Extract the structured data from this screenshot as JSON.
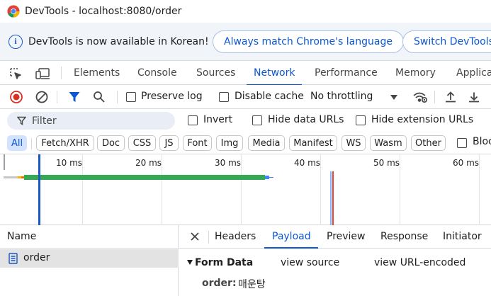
{
  "window": {
    "title": "DevTools - localhost:8080/order"
  },
  "infobar": {
    "message": "DevTools is now available in Korean!",
    "btn_match": "Always match Chrome's language",
    "btn_switch": "Switch DevTools"
  },
  "tabs": {
    "elements": "Elements",
    "console": "Console",
    "sources": "Sources",
    "network": "Network",
    "performance": "Performance",
    "memory": "Memory",
    "application": "Applica"
  },
  "toolbar": {
    "preserve_log": "Preserve log",
    "disable_cache": "Disable cache",
    "throttling": "No throttling"
  },
  "filterbar": {
    "placeholder": "Filter",
    "invert": "Invert",
    "hide_data_urls": "Hide data URLs",
    "hide_extension_urls": "Hide extension URLs"
  },
  "types": {
    "all": "All",
    "fetch": "Fetch/XHR",
    "doc": "Doc",
    "css": "CSS",
    "js": "JS",
    "font": "Font",
    "img": "Img",
    "media": "Media",
    "manifest": "Manifest",
    "ws": "WS",
    "wasm": "Wasm",
    "other": "Other",
    "blocked": "Bloc"
  },
  "timeline": {
    "t10": "10 ms",
    "t20": "20 ms",
    "t30": "30 ms",
    "t40": "40 ms",
    "t50": "50 ms",
    "t60": "60 ms"
  },
  "requests": {
    "header": "Name",
    "row1": "order"
  },
  "details": {
    "headers": "Headers",
    "payload": "Payload",
    "preview": "Preview",
    "response": "Response",
    "initiator": "Initiator"
  },
  "form": {
    "title": "Form Data",
    "view_source": "view source",
    "view_url_encoded": "view URL-encoded",
    "key": "order:",
    "value": "매운탕"
  },
  "colors": {
    "accent": "#0b57d0",
    "record_red": "#d93025",
    "bar_green": "#34a853"
  }
}
